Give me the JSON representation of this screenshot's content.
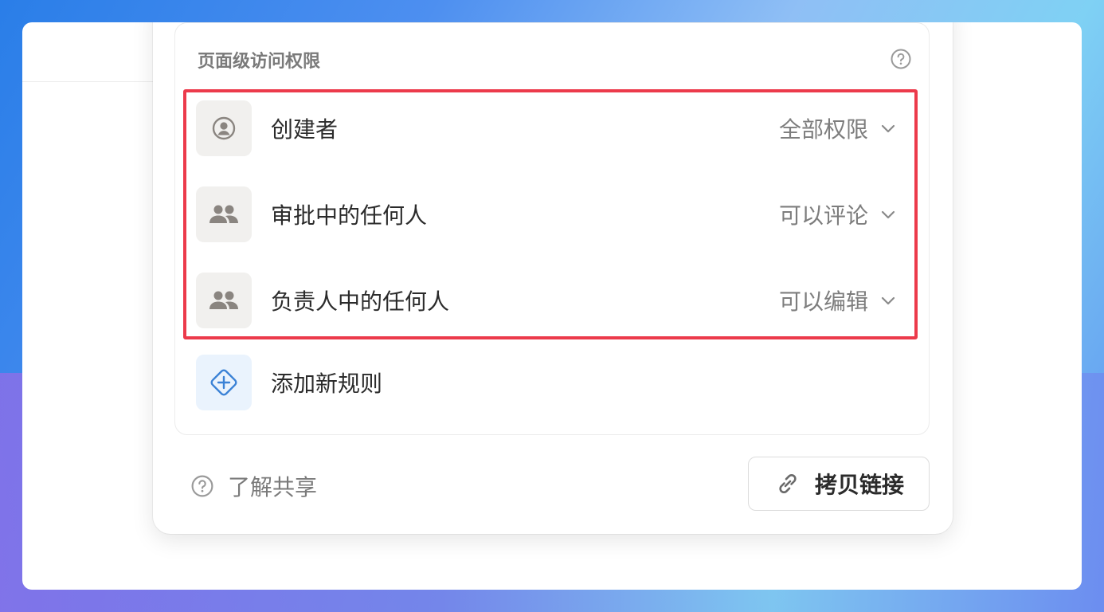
{
  "panel": {
    "section_title": "页面级访问权限",
    "rules": [
      {
        "label": "创建者",
        "permission": "全部权限",
        "icon": "person-circle-icon"
      },
      {
        "label": "审批中的任何人",
        "permission": "可以评论",
        "icon": "people-icon"
      },
      {
        "label": "负责人中的任何人",
        "permission": "可以编辑",
        "icon": "people-icon"
      }
    ],
    "add_rule_label": "添加新规则",
    "learn_sharing_label": "了解共享",
    "copy_link_label": "拷贝链接"
  },
  "colors": {
    "highlight_border": "#ec3a4b",
    "add_icon_blue": "#3b82d6",
    "icon_gray": "#8a8580"
  }
}
